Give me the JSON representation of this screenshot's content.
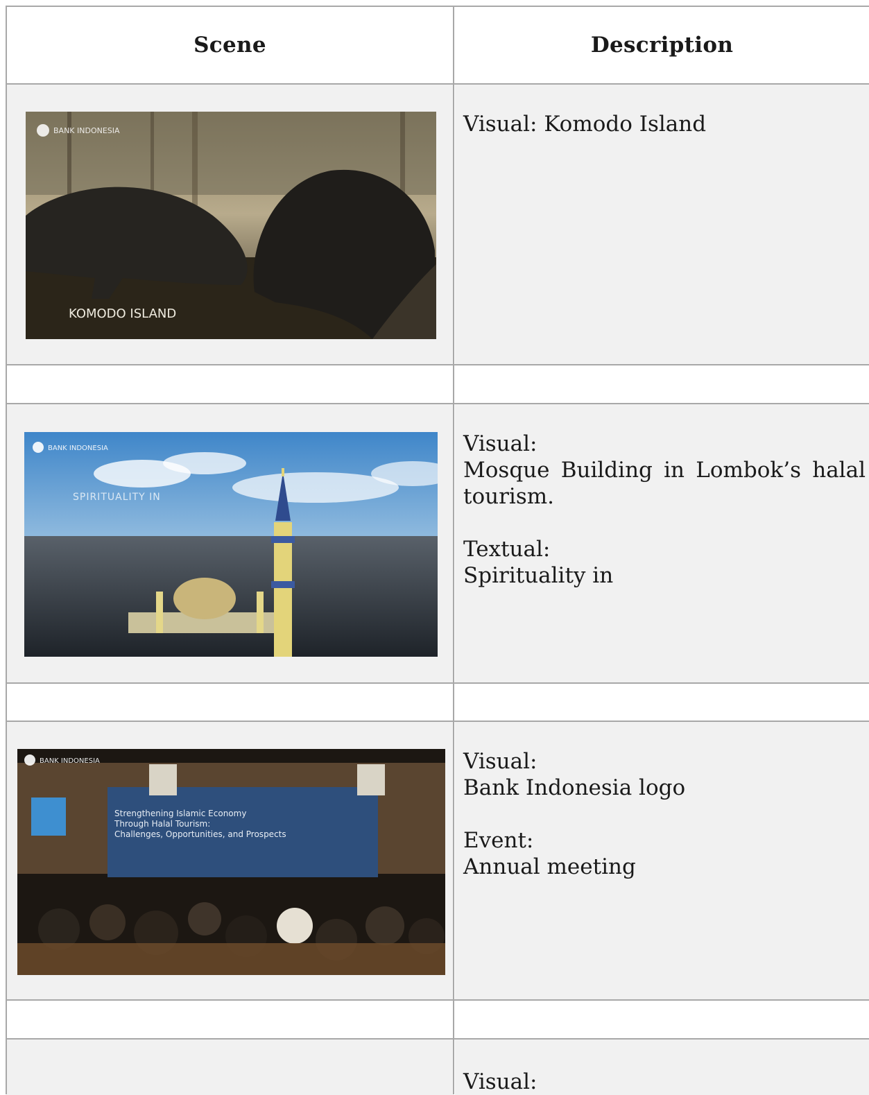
{
  "table": {
    "headers": {
      "scene": "Scene",
      "description": "Description"
    },
    "rows": [
      {
        "thumbnail": {
          "subject": "komodo-dragons",
          "overlay_text": "KOMODO ISLAND",
          "logo_text": "BANK INDONESIA"
        },
        "description": {
          "visual_label": "Visual: Komodo Island"
        }
      },
      {
        "thumbnail": {
          "subject": "mosque-aerial",
          "overlay_text": "SPIRITUALITY IN",
          "logo_text": "BANK INDONESIA"
        },
        "description": {
          "visual_label": "Visual:",
          "visual_text": "Mosque Building in Lombok’s halal tourism.",
          "textual_label": "Textual:",
          "textual_text": "Spirituality in"
        }
      },
      {
        "thumbnail": {
          "subject": "conference-hall",
          "logo_text": "BANK INDONESIA",
          "banner_lines": [
            "Strengthening Islamic Economy",
            "Through Halal Tourism:",
            "Challenges, Opportunities, and Prospects"
          ]
        },
        "description": {
          "visual_label": "Visual:",
          "visual_text": "Bank Indonesia logo",
          "event_label": "Event:",
          "event_text": "Annual meeting"
        }
      },
      {
        "description": {
          "visual_label": "Visual:"
        }
      }
    ]
  }
}
